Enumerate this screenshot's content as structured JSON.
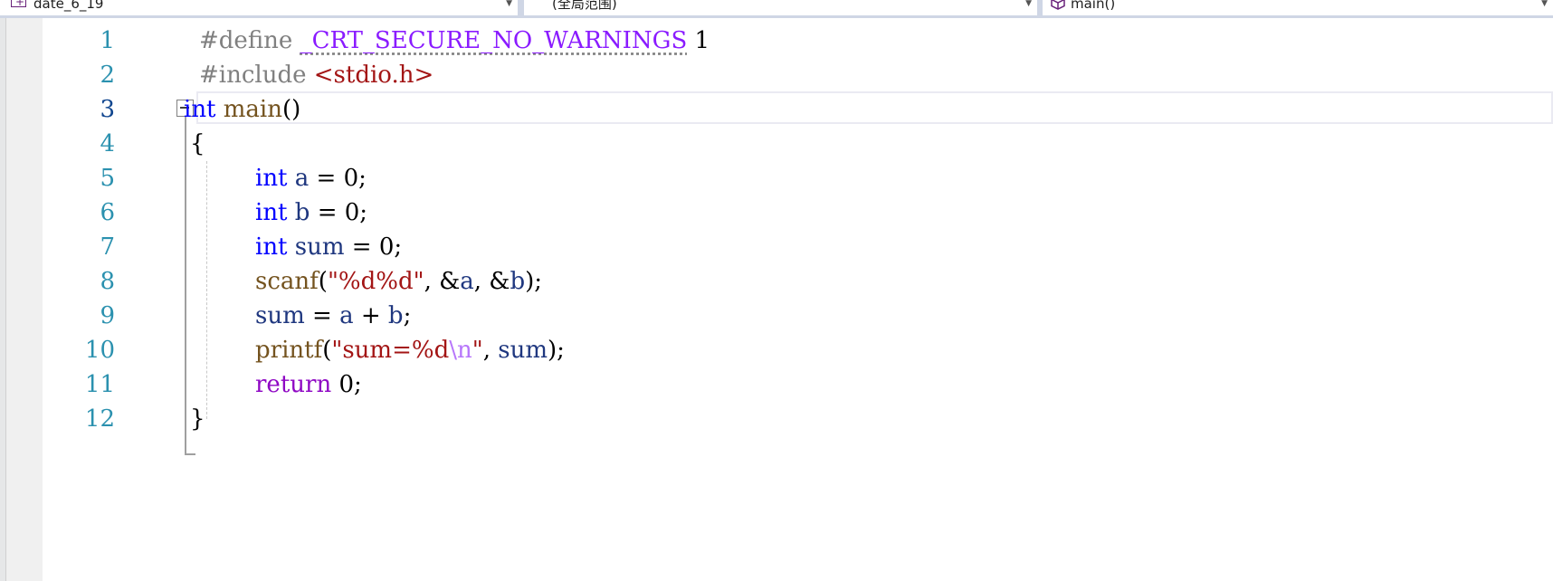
{
  "navbar": {
    "project": "date_6_19",
    "scope": "(全局范围)",
    "member": "main()"
  },
  "line_numbers": [
    "1",
    "2",
    "3",
    "4",
    "5",
    "6",
    "7",
    "8",
    "9",
    "10",
    "11",
    "12"
  ],
  "current_line": 3,
  "code": {
    "l1": {
      "define": "#define",
      "macro": "_CRT_SECURE_NO_WARNINGS",
      "value": "1"
    },
    "l2": {
      "include": "#include",
      "header": "<stdio.h>"
    },
    "l3": {
      "type": "int",
      "name": "main",
      "parens": "()"
    },
    "l4": {
      "brace": "{"
    },
    "l5": {
      "type": "int",
      "var": "a",
      "rest": " = 0;"
    },
    "l6": {
      "type": "int",
      "var": "b",
      "rest": " = 0;"
    },
    "l7": {
      "type": "int",
      "var": "sum",
      "rest": " = 0;"
    },
    "l8": {
      "fn": "scanf",
      "open": "(",
      "str": "\"%d%d\"",
      "sep1": ", &",
      "a": "a",
      "sep2": ", &",
      "b": "b",
      "close": ");"
    },
    "l9": {
      "sum": "sum",
      "eq": " = ",
      "a": "a",
      "plus": " + ",
      "b": "b",
      "semi": ";"
    },
    "l10": {
      "fn": "printf",
      "open": "(",
      "str1": "\"sum=%d",
      "esc": "\\n",
      "str2": "\"",
      "sep": ", ",
      "sum": "sum",
      "close": ");"
    },
    "l11": {
      "kw": "return",
      "rest": " 0;"
    },
    "l12": {
      "brace": "}"
    }
  }
}
